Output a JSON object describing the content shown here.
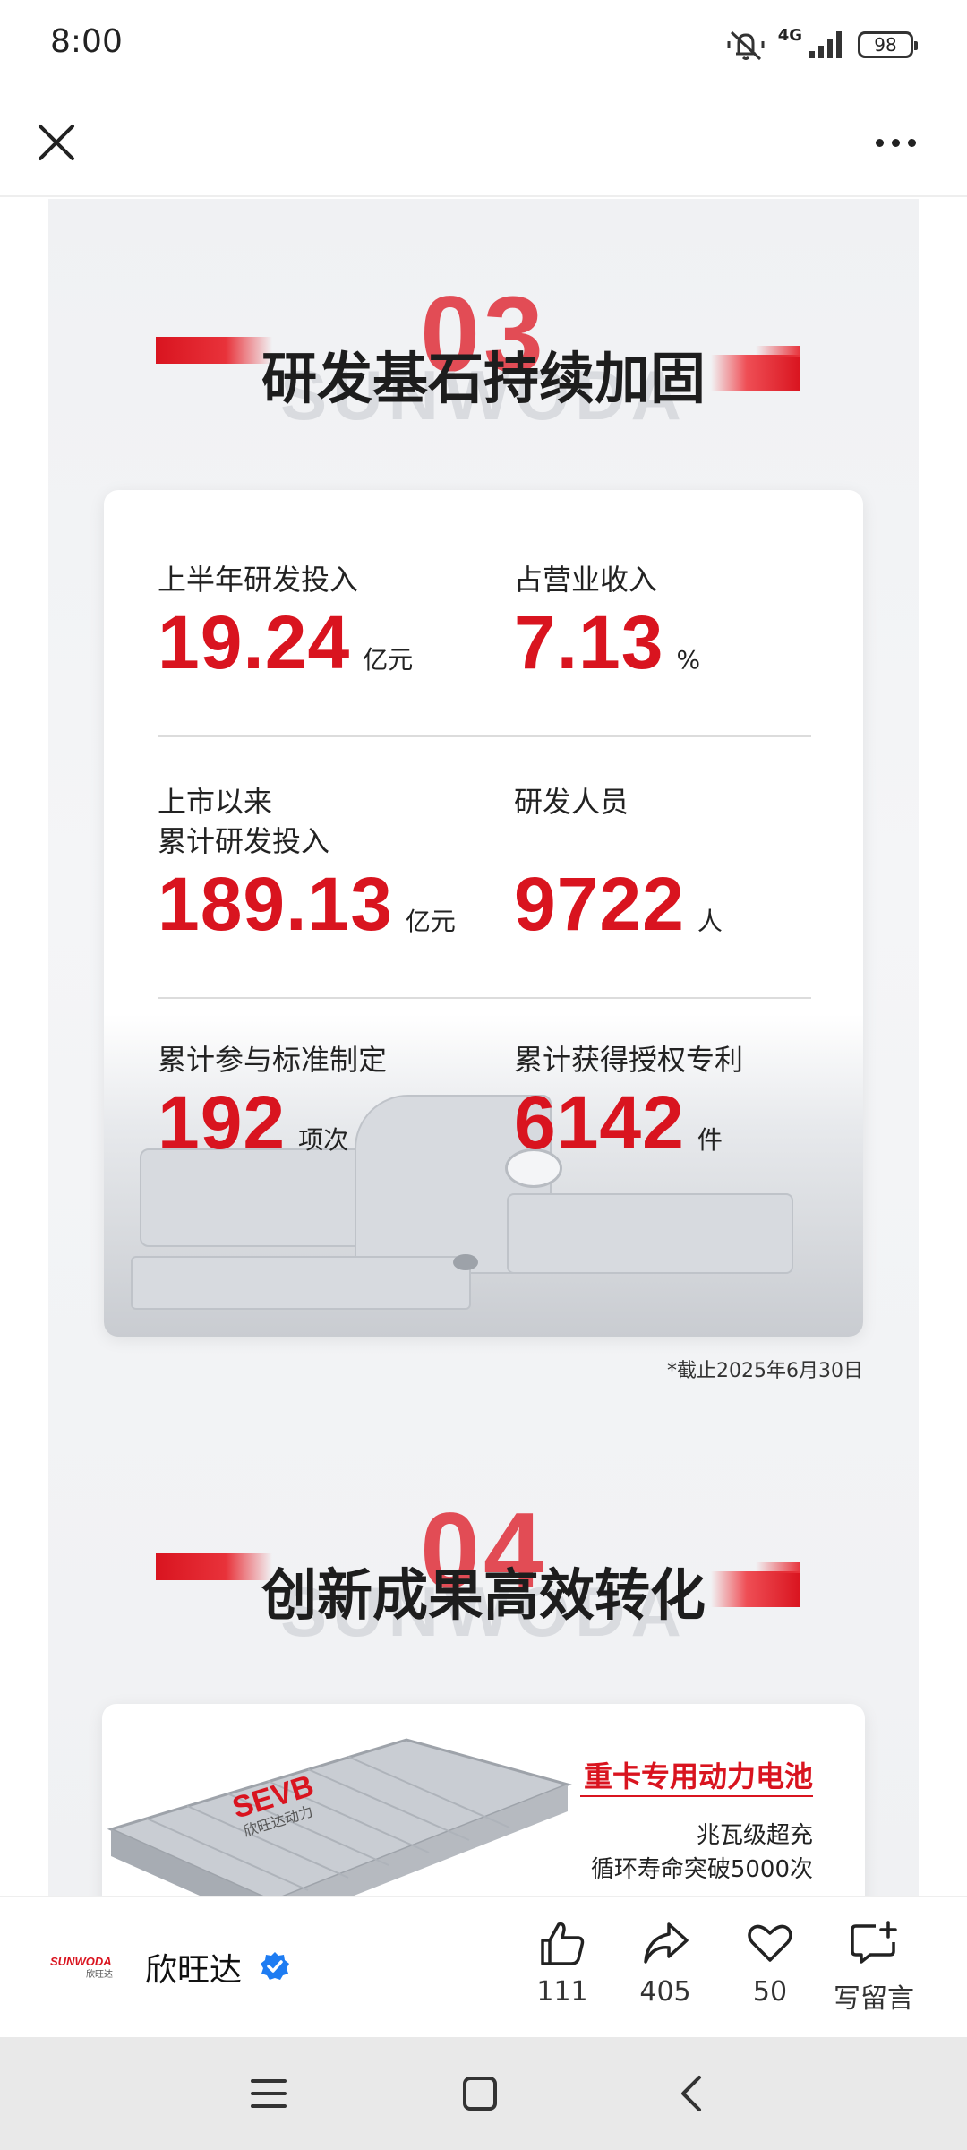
{
  "status_bar": {
    "time": "8:00",
    "network": "4G",
    "battery": "98"
  },
  "section3": {
    "number": "03",
    "watermark": "SUNWODA",
    "title": "研发基石持续加固",
    "stats": [
      {
        "label": "上半年研发投入",
        "value": "19.24",
        "unit": "亿元"
      },
      {
        "label": "占营业收入",
        "value": "7.13",
        "unit": "%"
      },
      {
        "label": "上市以来\n累计研发投入",
        "value": "189.13",
        "unit": "亿元"
      },
      {
        "label": "研发人员",
        "value": "9722",
        "unit": "人"
      },
      {
        "label": "累计参与标准制定",
        "value": "192",
        "unit": "项次"
      },
      {
        "label": "累计获得授权专利",
        "value": "6142",
        "unit": "件"
      }
    ],
    "footnote": "*截止2025年6月30日"
  },
  "section4": {
    "number": "04",
    "watermark": "SUNWODA",
    "title": "创新成果高效转化",
    "battery_card": {
      "title": "重卡专用动力电池",
      "brand": "SEVB",
      "brand_cn": "欣旺达动力",
      "lines": [
        "兆瓦级超充",
        "循环寿命突破5000次"
      ]
    }
  },
  "author": {
    "logo_text": "SUNWODA",
    "logo_sub": "欣旺达",
    "name": "欣旺达"
  },
  "actions": {
    "like_count": "111",
    "share_count": "405",
    "favorite_count": "50",
    "comment_label": "写留言"
  },
  "colors": {
    "brand_red": "#d9141f",
    "verified_blue": "#1e7cf2"
  }
}
